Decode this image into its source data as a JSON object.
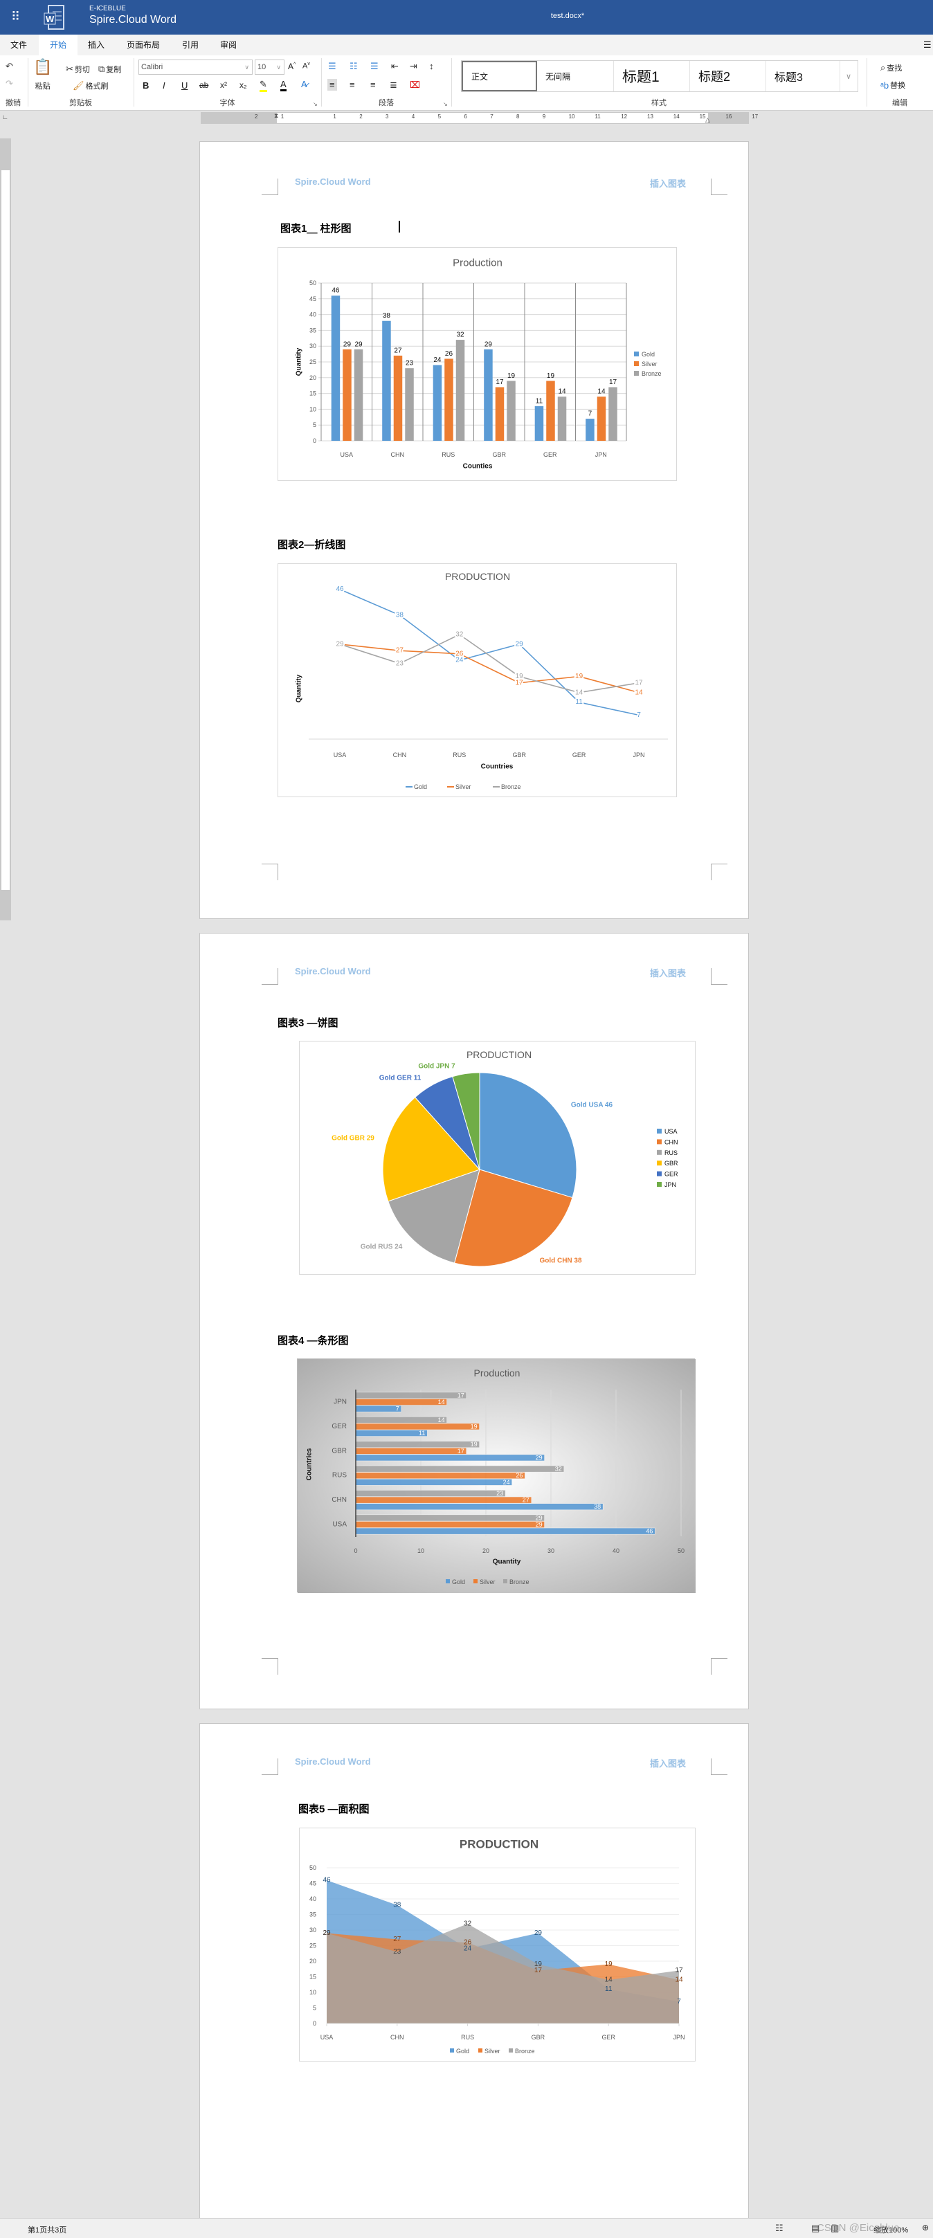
{
  "titlebar": {
    "brand_top": "E-ICEBLUE",
    "brand": "Spire.Cloud Word",
    "doc_title": "test.docx*",
    "apps_icon": "grid-icon",
    "logo_icon": "word-document-icon"
  },
  "tabs": [
    {
      "label": "文件"
    },
    {
      "label": "开始",
      "active": true
    },
    {
      "label": "插入"
    },
    {
      "label": "页面布局"
    },
    {
      "label": "引用"
    },
    {
      "label": "审阅"
    }
  ],
  "ribbon": {
    "undo_group": {
      "label": "撤销"
    },
    "clipboard": {
      "label": "剪贴板",
      "paste": "粘贴",
      "cut": "剪切",
      "copy": "复制",
      "format_painter": "格式刷"
    },
    "font": {
      "label": "字体",
      "name": "Calibri",
      "size": "10",
      "bold": "B",
      "italic": "I",
      "underline": "U",
      "strike": "ab",
      "superscript": "x²",
      "subscript": "x₂"
    },
    "paragraph": {
      "label": "段落"
    },
    "styles": {
      "label": "样式",
      "items": [
        "正文",
        "无间隔",
        "标题1",
        "标题2",
        "标题3"
      ]
    },
    "editing": {
      "label": "编辑",
      "find": "查找",
      "replace": "替换"
    }
  },
  "ruler": {
    "ticks": [
      "2",
      "1",
      "",
      "1",
      "2",
      "3",
      "4",
      "5",
      "6",
      "7",
      "8",
      "9",
      "10",
      "11",
      "12",
      "13",
      "14",
      "15",
      "16",
      "17"
    ]
  },
  "header": {
    "left": "Spire.Cloud Word",
    "right": "插入图表"
  },
  "headings": [
    "图表1＿ 柱形图",
    "图表2—折线图",
    "图表3 —饼图",
    "图表4 —条形图",
    "图表5 —面积图"
  ],
  "status": {
    "page_info": "第1页共3页",
    "zoom": "缩放100%",
    "watermark": "CSDN @Eiceblue"
  },
  "colors": {
    "gold": "#5b9bd5",
    "silver": "#ed7d31",
    "bronze": "#a5a5a5",
    "gbr": "#ffc000",
    "ger": "#4472c4",
    "jpn": "#70ad47",
    "titlebar": "#2b579a"
  },
  "chart_data": [
    {
      "type": "bar",
      "title": "Production",
      "xlabel": "Counties",
      "ylabel": "Quantity",
      "categories": [
        "USA",
        "CHN",
        "RUS",
        "GBR",
        "GER",
        "JPN"
      ],
      "ylim": [
        0,
        50
      ],
      "yticks": [
        "0",
        "5",
        "10",
        "15",
        "20",
        "25",
        "30",
        "35",
        "40",
        "45",
        "50"
      ],
      "legend": "right",
      "grid": true,
      "series": [
        {
          "name": "Gold",
          "values": [
            46,
            38,
            24,
            29,
            11,
            7
          ]
        },
        {
          "name": "Silver",
          "values": [
            29,
            27,
            26,
            17,
            19,
            14
          ]
        },
        {
          "name": "Bronze",
          "values": [
            29,
            23,
            32,
            19,
            14,
            17
          ]
        }
      ]
    },
    {
      "type": "line",
      "title": "PRODUCTION",
      "xlabel": "Countries",
      "ylabel": "Quantity",
      "categories": [
        "USA",
        "CHN",
        "RUS",
        "GBR",
        "GER",
        "JPN"
      ],
      "ylim": [
        0,
        50
      ],
      "legend": "bottom",
      "grid": false,
      "series": [
        {
          "name": "Gold",
          "values": [
            46,
            38,
            24,
            29,
            11,
            7
          ]
        },
        {
          "name": "Silver",
          "values": [
            29,
            27,
            26,
            17,
            19,
            14
          ]
        },
        {
          "name": "Bronze",
          "values": [
            29,
            23,
            32,
            19,
            14,
            17
          ]
        }
      ]
    },
    {
      "type": "pie",
      "title": "PRODUCTION",
      "legend": "right",
      "categories": [
        "USA",
        "CHN",
        "RUS",
        "GBR",
        "GER",
        "JPN"
      ],
      "values": [
        46,
        38,
        24,
        29,
        11,
        7
      ],
      "series_name": "Gold",
      "labels": [
        "Gold USA 46",
        "Gold CHN 38",
        "Gold RUS 24",
        "Gold GBR 29",
        "Gold GER 11",
        "Gold JPN 7"
      ]
    },
    {
      "type": "bar",
      "orientation": "horizontal",
      "title": "Production",
      "xlabel": "Quantity",
      "ylabel": "Countries",
      "categories": [
        "USA",
        "CHN",
        "RUS",
        "GBR",
        "GER",
        "JPN"
      ],
      "xlim": [
        0,
        50
      ],
      "xticks": [
        "0",
        "10",
        "20",
        "30",
        "40",
        "50"
      ],
      "legend": "bottom",
      "grid": true,
      "series": [
        {
          "name": "Gold",
          "values": [
            46,
            38,
            24,
            29,
            11,
            7
          ]
        },
        {
          "name": "Silver",
          "values": [
            29,
            27,
            26,
            17,
            19,
            14
          ]
        },
        {
          "name": "Bronze",
          "values": [
            29,
            23,
            32,
            19,
            14,
            17
          ]
        }
      ]
    },
    {
      "type": "area",
      "title": "PRODUCTION",
      "categories": [
        "USA",
        "CHN",
        "RUS",
        "GBR",
        "GER",
        "JPN"
      ],
      "ylim": [
        0,
        50
      ],
      "yticks": [
        "0",
        "5",
        "10",
        "15",
        "20",
        "25",
        "30",
        "35",
        "40",
        "45",
        "50"
      ],
      "legend": "bottom",
      "grid": true,
      "series": [
        {
          "name": "Gold",
          "values": [
            46,
            38,
            24,
            29,
            11,
            7
          ]
        },
        {
          "name": "Silver",
          "values": [
            29,
            27,
            26,
            17,
            19,
            14
          ]
        },
        {
          "name": "Bronze",
          "values": [
            29,
            23,
            32,
            19,
            14,
            17
          ]
        }
      ]
    }
  ]
}
